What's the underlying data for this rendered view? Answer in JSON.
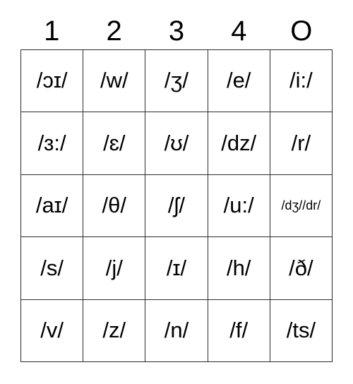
{
  "card": {
    "type": "bingo-card",
    "title_headers": [
      "1",
      "2",
      "3",
      "4",
      "O"
    ],
    "columns": 5,
    "rows": 5,
    "border_color": "#2b2b2b",
    "background_color": "#ffffff",
    "text_color": "#000000",
    "cells": [
      [
        {
          "text": "/ɔɪ/",
          "size": "normal"
        },
        {
          "text": "/w/",
          "size": "normal"
        },
        {
          "text": "/ʒ/",
          "size": "normal"
        },
        {
          "text": "/e/",
          "size": "normal"
        },
        {
          "text": "/i:/",
          "size": "normal"
        }
      ],
      [
        {
          "text": "/ɜ:/",
          "size": "normal"
        },
        {
          "text": "/ɛ/",
          "size": "normal"
        },
        {
          "text": "/ʊ/",
          "size": "normal"
        },
        {
          "text": "/dz/",
          "size": "normal"
        },
        {
          "text": "/r/",
          "size": "normal"
        }
      ],
      [
        {
          "text": "/aɪ/",
          "size": "normal"
        },
        {
          "text": "/θ/",
          "size": "normal"
        },
        {
          "text": "/ʃ/",
          "size": "normal"
        },
        {
          "text": "/u:/",
          "size": "normal"
        },
        {
          "text": "/dʒ//dr/",
          "size": "small"
        }
      ],
      [
        {
          "text": "/s/",
          "size": "normal"
        },
        {
          "text": "/j/",
          "size": "normal"
        },
        {
          "text": "/ɪ/",
          "size": "normal"
        },
        {
          "text": "/h/",
          "size": "normal"
        },
        {
          "text": "/ð/",
          "size": "normal"
        }
      ],
      [
        {
          "text": "/v/",
          "size": "normal"
        },
        {
          "text": "/z/",
          "size": "normal"
        },
        {
          "text": "/n/",
          "size": "normal"
        },
        {
          "text": "/f/",
          "size": "normal"
        },
        {
          "text": "/ts/",
          "size": "normal"
        }
      ]
    ]
  }
}
